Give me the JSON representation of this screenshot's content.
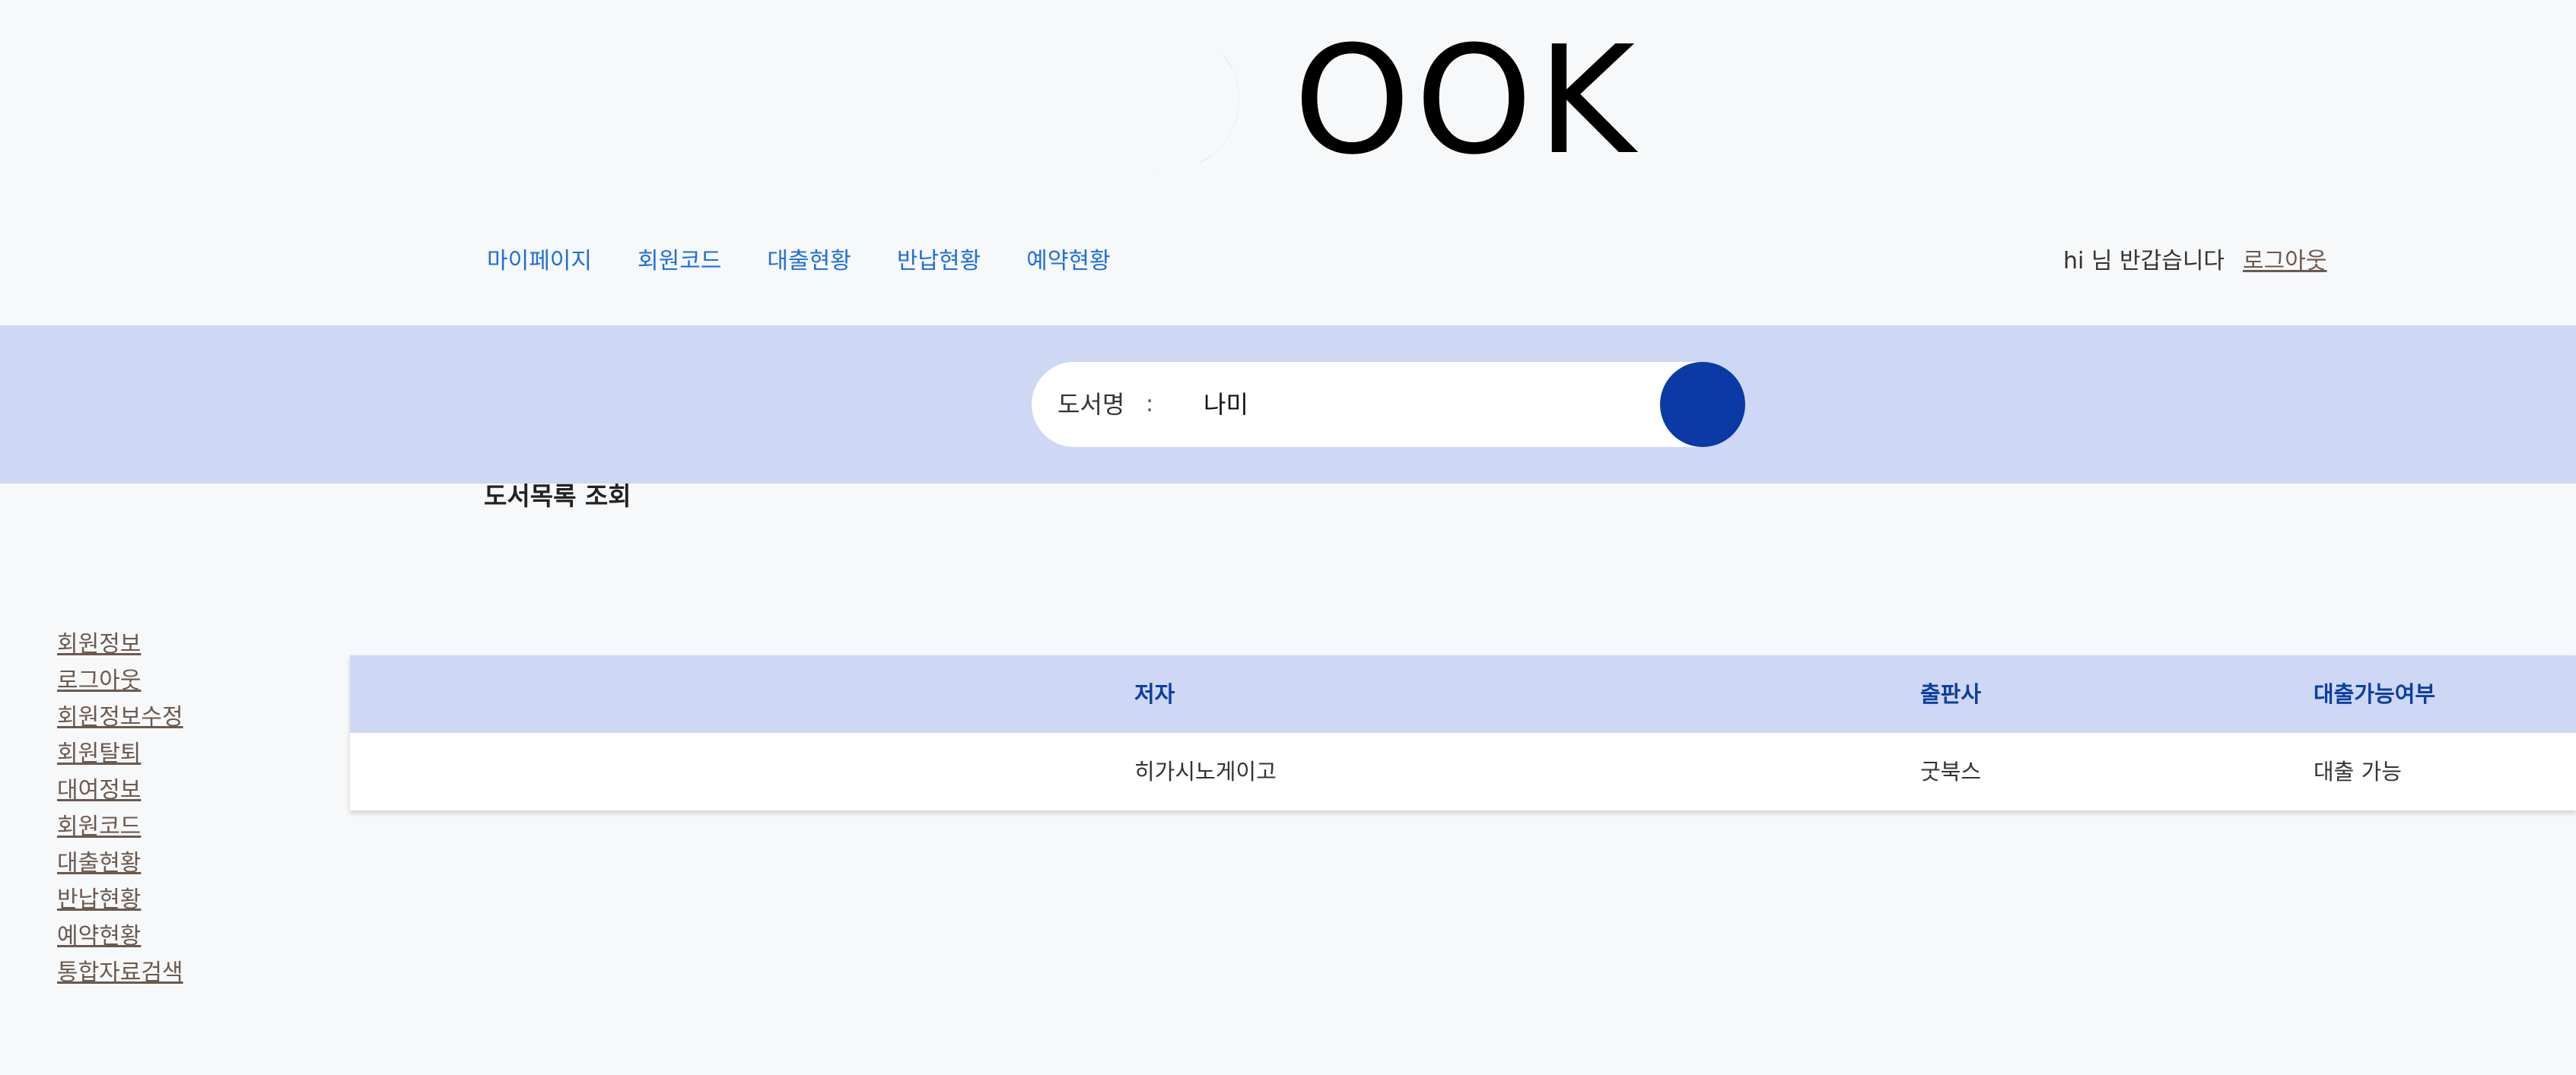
{
  "logo": {
    "text": "OOK",
    "moon_color_top": "#0a0f9a",
    "moon_color_bottom": "#0a6aa8"
  },
  "nav": {
    "items": [
      "마이페이지",
      "회원코드",
      "대출현황",
      "반납현황",
      "예약현황"
    ],
    "greeting": "hi 님 반갑습니다",
    "logout_label": "로그아웃"
  },
  "search": {
    "label": "도서명",
    "colon": ":",
    "value": "나미",
    "button_icon": "search-icon"
  },
  "page_title": "도서목록 조회",
  "sidebar": {
    "items": [
      "회원정보",
      "로그아웃",
      "회원정보수정",
      "회원탈퇴",
      "대여정보",
      "회원코드",
      "대출현황",
      "반납현황",
      "예약현황",
      "통합자료검색"
    ]
  },
  "table": {
    "headers": [
      "저자",
      "출판사",
      "대출가능여부"
    ],
    "rows": [
      [
        "히가시노게이고",
        "굿북스",
        "대출 가능"
      ]
    ]
  },
  "colors": {
    "accent": "#0b3aa6",
    "band": "#ced7f3",
    "nav_link": "#1e6fd9",
    "header_text": "#0d3fa0"
  }
}
